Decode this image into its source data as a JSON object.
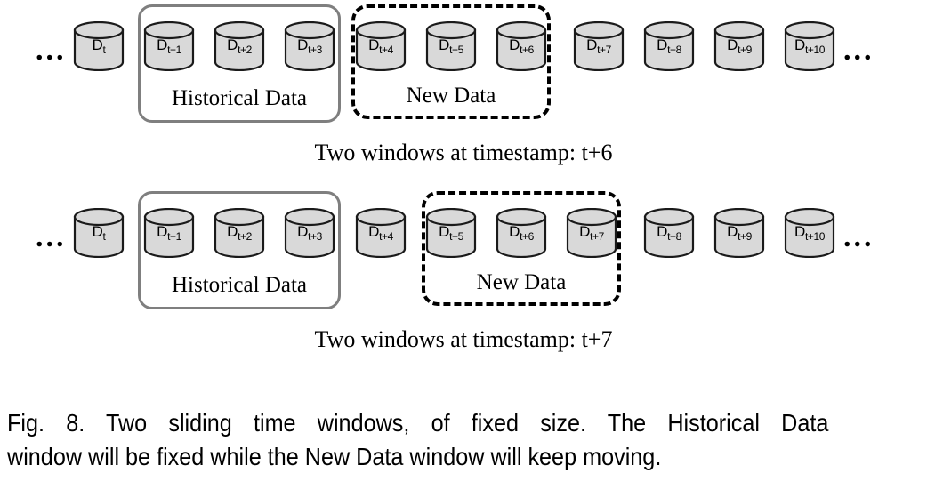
{
  "figure": {
    "caption_label": "Fig. 8.",
    "caption_line1": "Fig. 8. Two sliding time windows, of fixed size. The Historical Data",
    "caption_line2": "window will be fixed while the New Data window will keep moving.",
    "colors": {
      "cylinder_fill": "#d9d9d9",
      "cylinder_stroke": "#1a1a1a",
      "historical_box_stroke": "#7f7f7f",
      "new_box_stroke": "#000000",
      "background": "#ffffff",
      "text": "#000000"
    }
  },
  "rows": [
    {
      "id": "row-timestamp-t6",
      "caption": "Two windows at timestamp: t+6",
      "leading_ellipsis": "...",
      "trailing_ellipsis": "...",
      "historical_window": {
        "label": "Historical Data",
        "style": "solid",
        "members": [
          "D t+1",
          "D t+2",
          "D t+3"
        ]
      },
      "new_window": {
        "label": "New Data",
        "style": "dashed",
        "members": [
          "D t+4",
          "D t+5",
          "D t+6"
        ]
      },
      "cylinders": [
        {
          "base": "D",
          "sub": "t"
        },
        {
          "base": "D",
          "sub": "t+1"
        },
        {
          "base": "D",
          "sub": "t+2"
        },
        {
          "base": "D",
          "sub": "t+3"
        },
        {
          "base": "D",
          "sub": "t+4"
        },
        {
          "base": "D",
          "sub": "t+5"
        },
        {
          "base": "D",
          "sub": "t+6"
        },
        {
          "base": "D",
          "sub": "t+7"
        },
        {
          "base": "D",
          "sub": "t+8"
        },
        {
          "base": "D",
          "sub": "t+9"
        },
        {
          "base": "D",
          "sub": "t+10"
        }
      ]
    },
    {
      "id": "row-timestamp-t7",
      "caption": "Two windows at timestamp: t+7",
      "leading_ellipsis": "...",
      "trailing_ellipsis": "...",
      "historical_window": {
        "label": "Historical Data",
        "style": "solid",
        "members": [
          "D t+1",
          "D t+2",
          "D t+3"
        ]
      },
      "new_window": {
        "label": "New Data",
        "style": "dashed",
        "members": [
          "D t+5",
          "D t+6",
          "D t+7"
        ]
      },
      "cylinders": [
        {
          "base": "D",
          "sub": "t"
        },
        {
          "base": "D",
          "sub": "t+1"
        },
        {
          "base": "D",
          "sub": "t+2"
        },
        {
          "base": "D",
          "sub": "t+3"
        },
        {
          "base": "D",
          "sub": "t+4"
        },
        {
          "base": "D",
          "sub": "t+5"
        },
        {
          "base": "D",
          "sub": "t+6"
        },
        {
          "base": "D",
          "sub": "t+7"
        },
        {
          "base": "D",
          "sub": "t+8"
        },
        {
          "base": "D",
          "sub": "t+9"
        },
        {
          "base": "D",
          "sub": "t+10"
        }
      ]
    }
  ]
}
